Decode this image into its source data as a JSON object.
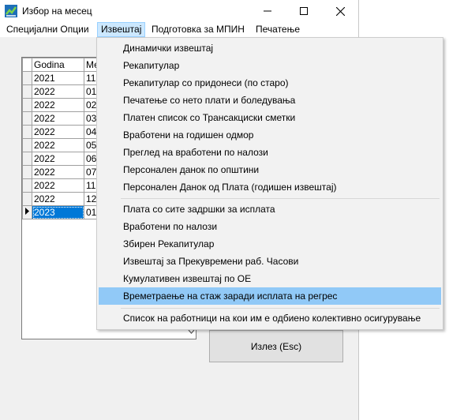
{
  "window": {
    "title": "Избор на месец",
    "controls": {
      "minimize": "minimize-icon",
      "maximize": "maximize-icon",
      "close": "close-icon"
    }
  },
  "menubar": {
    "items": [
      {
        "label": "Специјални Опции",
        "active": false
      },
      {
        "label": "Извештај",
        "active": true
      },
      {
        "label": "Подготовка за МПИН",
        "active": false
      },
      {
        "label": "Печатење",
        "active": false
      }
    ]
  },
  "grid": {
    "columns": [
      "Godina",
      "Ме"
    ],
    "rows": [
      {
        "year": "2021",
        "month": "11"
      },
      {
        "year": "2022",
        "month": "01"
      },
      {
        "year": "2022",
        "month": "02"
      },
      {
        "year": "2022",
        "month": "03"
      },
      {
        "year": "2022",
        "month": "04"
      },
      {
        "year": "2022",
        "month": "05"
      },
      {
        "year": "2022",
        "month": "06"
      },
      {
        "year": "2022",
        "month": "07"
      },
      {
        "year": "2022",
        "month": "11"
      },
      {
        "year": "2022",
        "month": "12"
      },
      {
        "year": "2023",
        "month": "01",
        "selected": true
      }
    ]
  },
  "exit_button": {
    "label": "Излез (Esc)"
  },
  "dropdown": {
    "group1": [
      "Динамички извештај",
      "Рекапитулар",
      "Рекапитулар со придонеси (по старо)",
      "Печатење со нето плати и боледувања",
      "Платен список со Трансакциски сметки",
      "Вработени на годишен одмор",
      "Преглед на вработени по налози",
      "Персонален данок по општини",
      "Персонален Данок од Плата (годишен извештај)"
    ],
    "group2": [
      "Плата со сите задршки за исплата",
      "Вработени по налози",
      "Збирен Рекапитулар",
      "Извештај за Прекувремени раб. Часови",
      "Кумулативен извештај по ОЕ",
      "Времетраење на стаж заради исплата на регрес"
    ],
    "group3": [
      "Список на работници на кои им е одбиено колективно осигурување"
    ],
    "highlighted": "Времетраење на стаж заради исплата на регрес",
    "highlight_color": "#91c9f7"
  }
}
